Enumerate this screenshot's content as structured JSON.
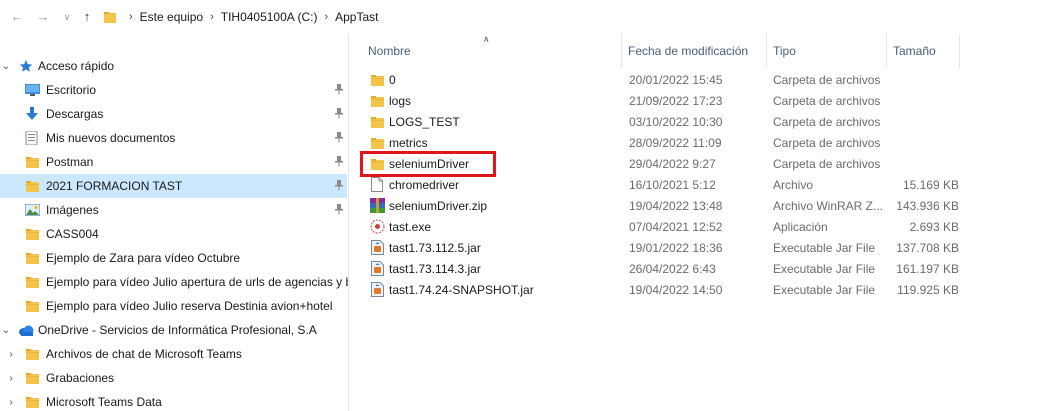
{
  "addressbar": {
    "crumbs": [
      "Este equipo",
      "TIH0405100A (C:)",
      "AppTast"
    ]
  },
  "nav": {
    "items": [
      {
        "label": "Acceso rápido",
        "icon": "star-icon",
        "chev": "v",
        "level": 0
      },
      {
        "label": "Escritorio",
        "icon": "desktop-icon",
        "pin": true,
        "level": 1
      },
      {
        "label": "Descargas",
        "icon": "download-icon",
        "pin": true,
        "level": 1
      },
      {
        "label": "Mis nuevos documentos",
        "icon": "documents-icon",
        "pin": true,
        "level": 1
      },
      {
        "label": "Postman",
        "icon": "folder-icon",
        "pin": true,
        "level": 1
      },
      {
        "label": "2021 FORMACION TAST",
        "icon": "folder-icon",
        "pin": true,
        "level": 1,
        "selected": true
      },
      {
        "label": "Imágenes",
        "icon": "pictures-icon",
        "pin": true,
        "level": 1
      },
      {
        "label": "CASS004",
        "icon": "folder-icon",
        "level": 1
      },
      {
        "label": "Ejemplo de Zara para vídeo Octubre",
        "icon": "folder-icon",
        "level": 1
      },
      {
        "label": "Ejemplo para vídeo Julio apertura de urls de agencias y bu",
        "icon": "folder-icon",
        "level": 1
      },
      {
        "label": "Ejemplo para vídeo Julio reserva Destinia avion+hotel",
        "icon": "folder-icon",
        "level": 1
      },
      {
        "label": "OneDrive - Servicios de Informática Profesional, S.A",
        "icon": "cloud-icon",
        "chev": "v",
        "level": 0
      },
      {
        "label": "Archivos de chat de Microsoft Teams",
        "icon": "folder-icon",
        "chev": ">",
        "level": 1
      },
      {
        "label": "Grabaciones",
        "icon": "folder-icon",
        "chev": ">",
        "level": 1
      },
      {
        "label": "Microsoft Teams Data",
        "icon": "folder-icon",
        "chev": ">",
        "level": 1
      }
    ]
  },
  "columns": {
    "name": "Nombre",
    "date": "Fecha de modificación",
    "type": "Tipo",
    "size": "Tamaño"
  },
  "files": [
    {
      "name": "0",
      "date": "20/01/2022 15:45",
      "type": "Carpeta de archivos",
      "size": "",
      "icon": "folder-icon"
    },
    {
      "name": "logs",
      "date": "21/09/2022 17:23",
      "type": "Carpeta de archivos",
      "size": "",
      "icon": "folder-icon"
    },
    {
      "name": "LOGS_TEST",
      "date": "03/10/2022 10:30",
      "type": "Carpeta de archivos",
      "size": "",
      "icon": "folder-icon"
    },
    {
      "name": "metrics",
      "date": "28/09/2022 11:09",
      "type": "Carpeta de archivos",
      "size": "",
      "icon": "folder-icon"
    },
    {
      "name": "seleniumDriver",
      "date": "29/04/2022 9:27",
      "type": "Carpeta de archivos",
      "size": "",
      "icon": "folder-icon"
    },
    {
      "name": "chromedriver",
      "date": "16/10/2021 5:12",
      "type": "Archivo",
      "size": "15.169 KB",
      "icon": "file-icon"
    },
    {
      "name": "seleniumDriver.zip",
      "date": "19/04/2022 13:48",
      "type": "Archivo WinRAR Z...",
      "size": "143.936 KB",
      "icon": "winrar-icon"
    },
    {
      "name": "tast.exe",
      "date": "07/04/2021 12:52",
      "type": "Aplicación",
      "size": "2.693 KB",
      "icon": "exe-icon"
    },
    {
      "name": "tast1.73.112.5.jar",
      "date": "19/01/2022 18:36",
      "type": "Executable Jar File",
      "size": "137.708 KB",
      "icon": "jar-icon"
    },
    {
      "name": "tast1.73.114.3.jar",
      "date": "26/04/2022 6:43",
      "type": "Executable Jar File",
      "size": "161.197 KB",
      "icon": "jar-icon"
    },
    {
      "name": "tast1.74.24-SNAPSHOT.jar",
      "date": "19/04/2022 14:50",
      "type": "Executable Jar File",
      "size": "119.925 KB",
      "icon": "jar-icon"
    }
  ],
  "colors": {
    "selection": "#cce8ff",
    "highlight": "#e0161c",
    "folder": "#f3c649"
  }
}
